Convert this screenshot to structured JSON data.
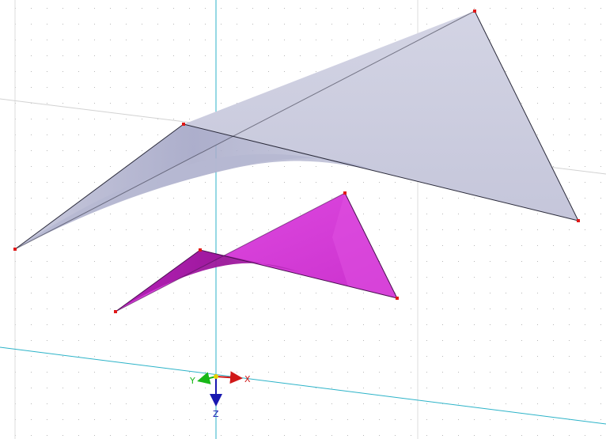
{
  "viewport": {
    "background": "#ffffff",
    "grid_dot_color": "#b8b8b8",
    "guide_line_color": "#d9d9d9",
    "axis_line_color": "#2cb3c8"
  },
  "surfaces": {
    "upper": {
      "fill": "#c7c8dc",
      "shadow": "#9fa1c2",
      "edge": "#2a2a3a"
    },
    "lower": {
      "fill": "#d53ed8",
      "shadow": "#a51aa8",
      "edge": "#4a1050"
    },
    "node_color": "#e01818"
  },
  "coordinate_system": {
    "x_label": "X",
    "y_label": "Y",
    "z_label": "Z",
    "x_color": "#d01818",
    "y_color": "#18b818",
    "z_color": "#1818b0",
    "origin_color": "#e8d000"
  }
}
